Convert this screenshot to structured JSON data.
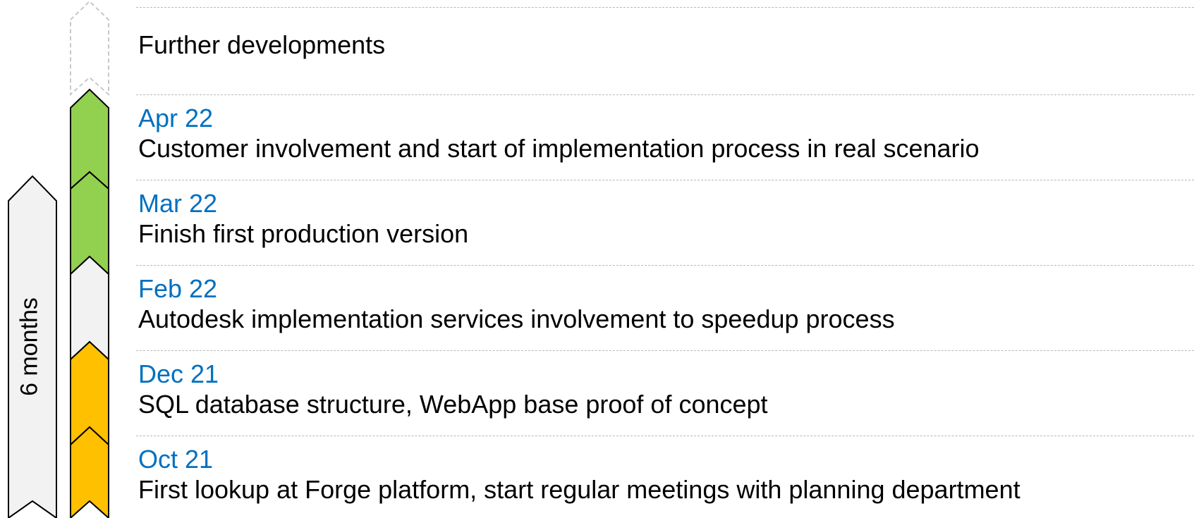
{
  "span_label": "6 months",
  "colors": {
    "date": "#0070c0",
    "green": "#92d050",
    "yellow": "#ffc000",
    "grey": "#f2f2f2",
    "dashed": "#b8b8b8"
  },
  "timeline": [
    {
      "date": "",
      "description": "Further developments",
      "status": "future"
    },
    {
      "date": "Apr 22",
      "description": "Customer involvement and start of implementation process in real scenario",
      "status": "green"
    },
    {
      "date": "Mar 22",
      "description": "Finish first production version",
      "status": "green"
    },
    {
      "date": "Feb 22",
      "description": "Autodesk implementation services involvement to speedup process",
      "status": "grey"
    },
    {
      "date": "Dec 21",
      "description": "SQL database structure, WebApp base proof of concept",
      "status": "yellow"
    },
    {
      "date": "Oct 21",
      "description": "First lookup at Forge platform, start regular meetings with planning department",
      "status": "yellow"
    }
  ]
}
